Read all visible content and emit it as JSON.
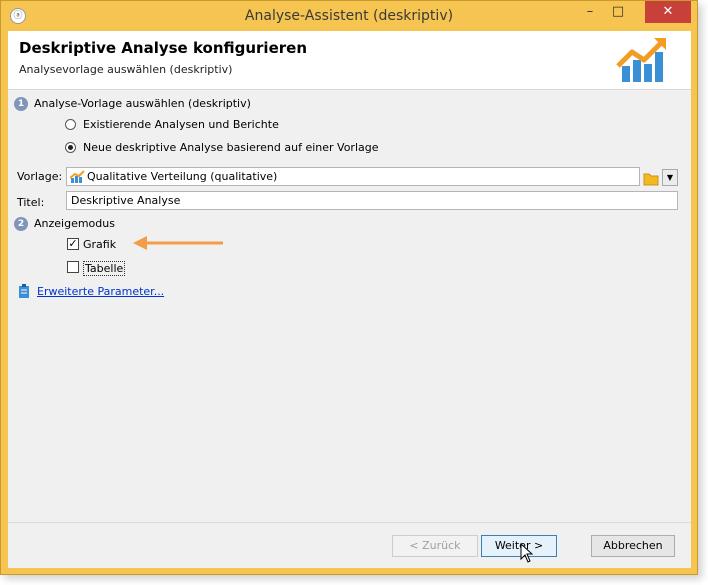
{
  "window": {
    "title": "Analyse-Assistent (deskriptiv)",
    "app_icon": "app-icon",
    "minimize": "–",
    "maximize": "□",
    "close": "✕"
  },
  "header": {
    "title": "Deskriptive Analyse konfigurieren",
    "subtitle": "Analysevorlage auswählen (deskriptiv)",
    "logo": "chart-growth-logo"
  },
  "step1": {
    "number": "1",
    "label": "Analyse-Vorlage auswählen (deskriptiv)",
    "options": [
      {
        "label": "Existierende Analysen und Berichte",
        "selected": false
      },
      {
        "label": "Neue deskriptive Analyse basierend auf einer Vorlage",
        "selected": true
      }
    ]
  },
  "template": {
    "label": "Vorlage:",
    "value": "Qualitative Verteilung (qualitative)"
  },
  "title_field": {
    "label": "Titel:",
    "value": "Deskriptive Analyse"
  },
  "step2": {
    "number": "2",
    "label": "Anzeigemodus",
    "options": [
      {
        "label": "Grafik",
        "checked": true
      },
      {
        "label": "Tabelle",
        "checked": false
      }
    ]
  },
  "advanced_link": "Erweiterte Parameter...",
  "annotation_color": "#f39c49",
  "buttons": {
    "back": "< Zurück",
    "next": "Weiter >",
    "cancel": "Abbrechen"
  }
}
